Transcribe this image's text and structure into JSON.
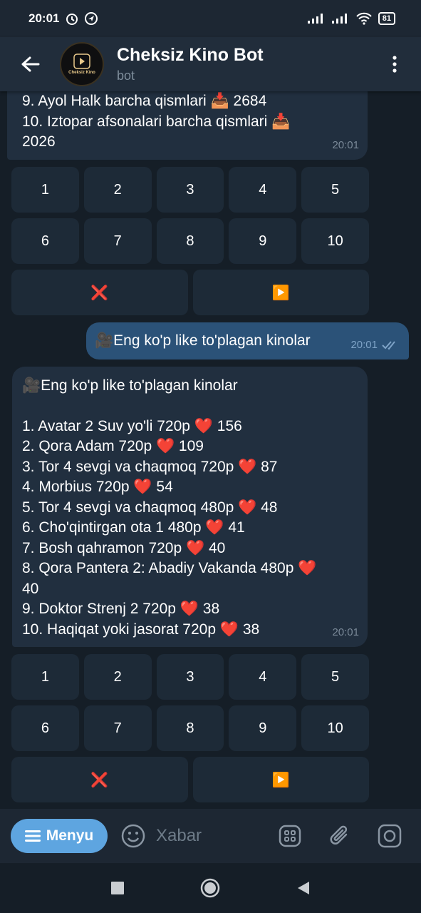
{
  "status": {
    "time": "20:01",
    "battery": "81"
  },
  "header": {
    "title": "Cheksiz Kino Bot",
    "subtitle": "bot",
    "avatar_text": "Cheksiz Kino"
  },
  "msg_prev": {
    "lines": [
      "9. Ayol Halk barcha qismlari 📥 2684",
      "10. Iztopar afsonalari barcha qismlari 📥",
      "2026"
    ],
    "time": "20:01"
  },
  "keyboard_1": {
    "row1": [
      "1",
      "2",
      "3",
      "4",
      "5"
    ],
    "row2": [
      "6",
      "7",
      "8",
      "9",
      "10"
    ],
    "row3": [
      "❌",
      "▶️"
    ]
  },
  "msg_out": {
    "text": "🎥Eng ko'p like to'plagan kinolar",
    "time": "20:01"
  },
  "msg_list": {
    "title": "🎥Eng ko'p like to'plagan kinolar",
    "lines": [
      "1. Avatar 2 Suv yo'li 720p ❤️ 156",
      "2. Qora Adam 720p ❤️ 109",
      "3. Tor 4 sevgi va chaqmoq 720p ❤️ 87",
      "4. Morbius 720p ❤️ 54",
      "5. Tor 4 sevgi va chaqmoq 480p ❤️ 48",
      "6. Cho'qintirgan ota 1 480p ❤️ 41",
      "7. Bosh qahramon 720p ❤️ 40",
      "8. Qora Pantera 2: Abadiy Vakanda 480p ❤️",
      "40",
      "9. Doktor Strenj 2 720p ❤️ 38",
      "10. Haqiqat yoki jasorat 720p ❤️ 38"
    ],
    "time": "20:01"
  },
  "keyboard_2": {
    "row1": [
      "1",
      "2",
      "3",
      "4",
      "5"
    ],
    "row2": [
      "6",
      "7",
      "8",
      "9",
      "10"
    ],
    "row3": [
      "❌",
      "▶️"
    ]
  },
  "input": {
    "menu_label": "Menyu",
    "placeholder": "Xabar"
  },
  "colors": {
    "accent": "#5ea5e0",
    "bubble_in": "#212f3f",
    "bubble_out": "#2b5278",
    "background": "#151e27"
  }
}
